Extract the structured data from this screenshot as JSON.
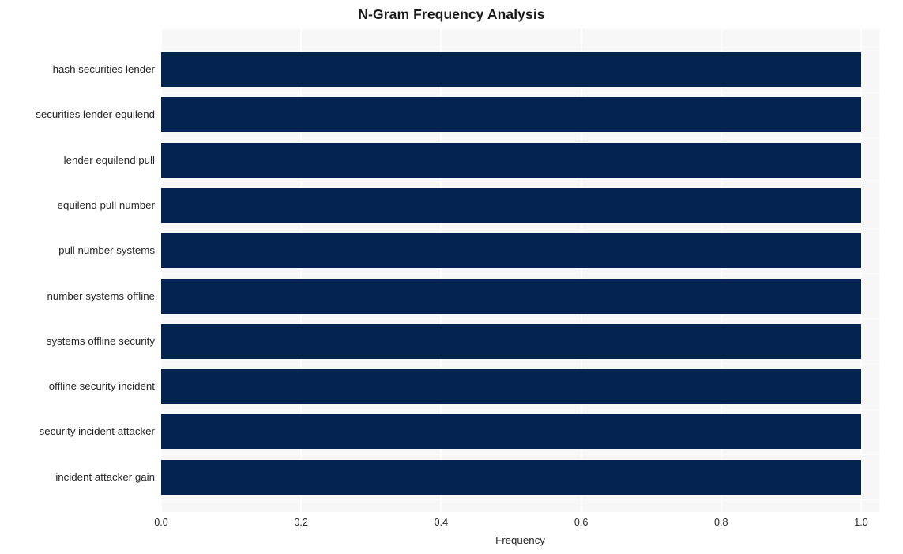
{
  "chart_data": {
    "type": "bar",
    "orientation": "horizontal",
    "title": "N-Gram Frequency Analysis",
    "xlabel": "Frequency",
    "ylabel": "",
    "categories": [
      "hash securities lender",
      "securities lender equilend",
      "lender equilend pull",
      "equilend pull number",
      "pull number systems",
      "number systems offline",
      "systems offline security",
      "offline security incident",
      "security incident attacker",
      "incident attacker gain"
    ],
    "values": [
      1.0,
      1.0,
      1.0,
      1.0,
      1.0,
      1.0,
      1.0,
      1.0,
      1.0,
      1.0
    ],
    "xlim": [
      0.0,
      1.0
    ],
    "xticks": [
      0.0,
      0.2,
      0.4,
      0.6,
      0.8,
      1.0
    ],
    "xtick_labels": [
      "0.0",
      "0.2",
      "0.4",
      "0.6",
      "0.8",
      "1.0"
    ],
    "grid": true,
    "grid_axis": "both",
    "legend": null,
    "bar_color": "#04234f",
    "plot_background": "#f7f7f7",
    "figure_background": "#ffffff",
    "text_color": "#262626",
    "title_color": "#1a1a1a"
  }
}
